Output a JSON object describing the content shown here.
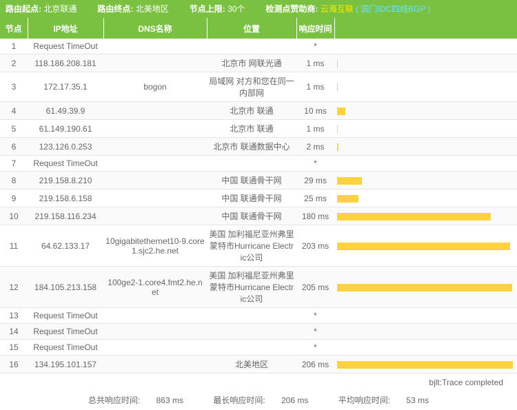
{
  "info": {
    "start_label": "路由起点:",
    "start_value": "北京联通",
    "end_label": "路由终点:",
    "end_value": "北美地区",
    "limit_label": "节点上限:",
    "limit_value": "30个",
    "sponsor_label": "检测点赞助商:",
    "sponsor_name": "云海互联",
    "sponsor_sub": "( 国门IDC四线BGP )"
  },
  "columns": {
    "node": "节点",
    "ip": "IP地址",
    "dns": "DNS名称",
    "location": "位置",
    "latency": "响应时间"
  },
  "max_ms": 206,
  "rows": [
    {
      "node": "1",
      "ip": "Request TimeOut",
      "dns": "",
      "loc": "",
      "lat": "*",
      "ms": 0
    },
    {
      "node": "2",
      "ip": "118.186.208.181",
      "dns": "",
      "loc": "北京市 网联光通",
      "lat": "1 ms",
      "ms": 1
    },
    {
      "node": "3",
      "ip": "172.17.35.1",
      "dns": "bogon",
      "loc": "局域网 对方和您在同一内部网",
      "lat": "1 ms",
      "ms": 1
    },
    {
      "node": "4",
      "ip": "61.49.39.9",
      "dns": "",
      "loc": "北京市 联通",
      "lat": "10 ms",
      "ms": 10
    },
    {
      "node": "5",
      "ip": "61.149.190.61",
      "dns": "",
      "loc": "北京市 联通",
      "lat": "1 ms",
      "ms": 1
    },
    {
      "node": "6",
      "ip": "123.126.0.253",
      "dns": "",
      "loc": "北京市 联通数据中心",
      "lat": "2 ms",
      "ms": 2
    },
    {
      "node": "7",
      "ip": "Request TimeOut",
      "dns": "",
      "loc": "",
      "lat": "*",
      "ms": 0
    },
    {
      "node": "8",
      "ip": "219.158.8.210",
      "dns": "",
      "loc": "中国 联通骨干网",
      "lat": "29 ms",
      "ms": 29
    },
    {
      "node": "9",
      "ip": "219.158.6.158",
      "dns": "",
      "loc": "中国 联通骨干网",
      "lat": "25 ms",
      "ms": 25
    },
    {
      "node": "10",
      "ip": "219.158.116.234",
      "dns": "",
      "loc": "中国 联通骨干网",
      "lat": "180 ms",
      "ms": 180
    },
    {
      "node": "11",
      "ip": "64.62.133.17",
      "dns": "10gigabitethernet10-9.core1.sjc2.he.net",
      "loc": "美国 加利福尼亚州弗里蒙特市Hurricane Electric公司",
      "lat": "203 ms",
      "ms": 203
    },
    {
      "node": "12",
      "ip": "184.105.213.158",
      "dns": "100ge2-1.core4.fmt2.he.net",
      "loc": "美国 加利福尼亚州弗里蒙特市Hurricane Electric公司",
      "lat": "205 ms",
      "ms": 205
    },
    {
      "node": "13",
      "ip": "Request TimeOut",
      "dns": "",
      "loc": "",
      "lat": "*",
      "ms": 0
    },
    {
      "node": "14",
      "ip": "Request TimeOut",
      "dns": "",
      "loc": "",
      "lat": "*",
      "ms": 0
    },
    {
      "node": "15",
      "ip": "Request TimeOut",
      "dns": "",
      "loc": "",
      "lat": "*",
      "ms": 0
    },
    {
      "node": "16",
      "ip": "134.195.101.157",
      "dns": "",
      "loc": "北美地区",
      "lat": "206 ms",
      "ms": 206
    }
  ],
  "status": "bjlt:Trace completed",
  "summary": {
    "total_label": "总共响应时间:",
    "total_value": "863 ms",
    "max_label": "最长响应时间:",
    "max_value": "206 ms",
    "avg_label": "平均响应时间:",
    "avg_value": "53 ms"
  }
}
